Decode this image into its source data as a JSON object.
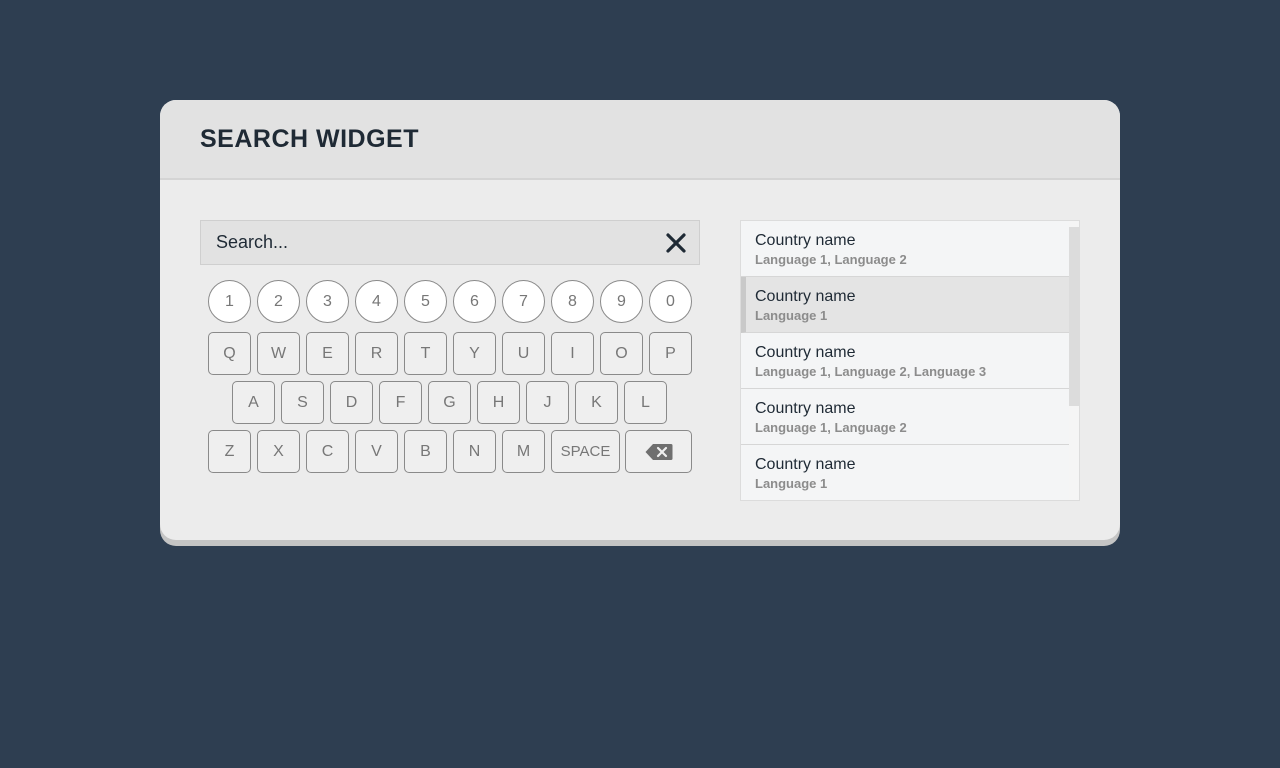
{
  "widget": {
    "title": "SEARCH WIDGET"
  },
  "search": {
    "placeholder": "Search...",
    "value": "",
    "clear_icon": "close-icon"
  },
  "keyboard": {
    "numbers": [
      "1",
      "2",
      "3",
      "4",
      "5",
      "6",
      "7",
      "8",
      "9",
      "0"
    ],
    "row1": [
      "Q",
      "W",
      "E",
      "R",
      "T",
      "Y",
      "U",
      "I",
      "O",
      "P"
    ],
    "row2": [
      "A",
      "S",
      "D",
      "F",
      "G",
      "H",
      "J",
      "K",
      "L"
    ],
    "row3": [
      "Z",
      "X",
      "C",
      "V",
      "B",
      "N",
      "M"
    ],
    "space_label": "SPACE",
    "backspace_icon": "backspace-icon"
  },
  "results": {
    "selected_index": 1,
    "items": [
      {
        "name": "Country name",
        "languages": "Language 1, Language 2"
      },
      {
        "name": "Country name",
        "languages": "Language 1"
      },
      {
        "name": "Country name",
        "languages": "Language 1, Language 2, Language 3"
      },
      {
        "name": "Country name",
        "languages": "Language 1, Language 2"
      },
      {
        "name": "Country name",
        "languages": "Language 1"
      }
    ]
  },
  "colors": {
    "background": "#2e3e51",
    "panel": "#ececec",
    "header": "#e2e2e2",
    "title_text": "#1f2a35",
    "key_text": "#777777",
    "secondary_text": "#8c8c8c"
  }
}
